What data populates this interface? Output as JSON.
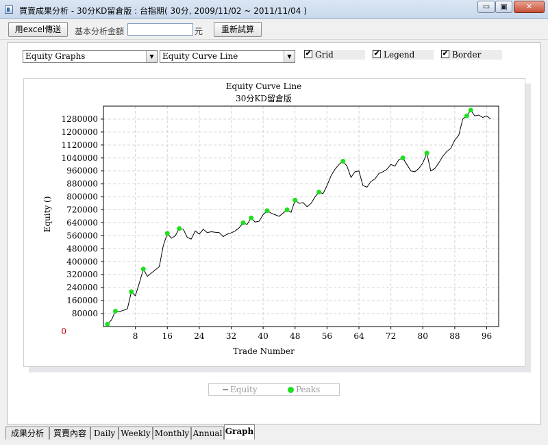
{
  "window": {
    "title": "買賣成果分析 - 30分KD留倉版 : 台指期( 30分, 2009/11/02 ~ 2011/11/04 )",
    "minimize_glyph": "▭",
    "maximize_glyph": "▣",
    "close_glyph": "✕"
  },
  "toolbar": {
    "export_label": "用excel傳送",
    "amount_label": "基本分析金額",
    "amount_value": "",
    "unit_label": "元",
    "recalc_label": "重新試算"
  },
  "controls": {
    "graph_type": "Equity Graphs",
    "graph_style": "Equity Curve Line",
    "dropdown_arrow": "▼",
    "check_mark": "✔",
    "grid": {
      "label": "Grid",
      "checked": true
    },
    "legend": {
      "label": "Legend",
      "checked": true
    },
    "border": {
      "label": "Border",
      "checked": true
    }
  },
  "chart_data": {
    "type": "line",
    "title": "Equity Curve Line",
    "subtitle": "30分KD留倉版",
    "xlabel": "Trade Number",
    "ylabel": "Equity ()",
    "xlim": [
      0,
      99
    ],
    "ylim": [
      0,
      1360000
    ],
    "x_ticks": [
      "8",
      "16",
      "24",
      "32",
      "40",
      "48",
      "56",
      "64",
      "72",
      "80",
      "88",
      "96"
    ],
    "y_ticks": [
      "80000",
      "160000",
      "240000",
      "320000",
      "400000",
      "480000",
      "560000",
      "640000",
      "720000",
      "800000",
      "880000",
      "960000",
      "1040000",
      "1120000",
      "1200000",
      "1280000"
    ],
    "zero_label": "0",
    "grid": true,
    "legend_position": "bottom",
    "series": [
      {
        "name": "Equity",
        "color": "#000000",
        "points": [
          [
            1,
            15000
          ],
          [
            2,
            40000
          ],
          [
            3,
            95000
          ],
          [
            4,
            92000
          ],
          [
            5,
            100000
          ],
          [
            6,
            110000
          ],
          [
            7,
            215000
          ],
          [
            8,
            190000
          ],
          [
            9,
            270000
          ],
          [
            10,
            355000
          ],
          [
            11,
            310000
          ],
          [
            12,
            330000
          ],
          [
            13,
            350000
          ],
          [
            14,
            370000
          ],
          [
            15,
            500000
          ],
          [
            16,
            575000
          ],
          [
            17,
            545000
          ],
          [
            18,
            560000
          ],
          [
            19,
            605000
          ],
          [
            20,
            600000
          ],
          [
            21,
            550000
          ],
          [
            22,
            540000
          ],
          [
            23,
            590000
          ],
          [
            24,
            570000
          ],
          [
            25,
            600000
          ],
          [
            26,
            580000
          ],
          [
            27,
            585000
          ],
          [
            28,
            582000
          ],
          [
            29,
            580000
          ],
          [
            30,
            555000
          ],
          [
            31,
            570000
          ],
          [
            32,
            578000
          ],
          [
            33,
            590000
          ],
          [
            34,
            610000
          ],
          [
            35,
            640000
          ],
          [
            36,
            630000
          ],
          [
            37,
            670000
          ],
          [
            38,
            645000
          ],
          [
            39,
            650000
          ],
          [
            40,
            690000
          ],
          [
            41,
            715000
          ],
          [
            42,
            700000
          ],
          [
            43,
            690000
          ],
          [
            44,
            680000
          ],
          [
            45,
            700000
          ],
          [
            46,
            720000
          ],
          [
            47,
            705000
          ],
          [
            48,
            780000
          ],
          [
            49,
            760000
          ],
          [
            50,
            765000
          ],
          [
            51,
            740000
          ],
          [
            52,
            760000
          ],
          [
            53,
            800000
          ],
          [
            54,
            830000
          ],
          [
            55,
            820000
          ],
          [
            56,
            870000
          ],
          [
            57,
            930000
          ],
          [
            58,
            970000
          ],
          [
            59,
            1000000
          ],
          [
            60,
            1020000
          ],
          [
            61,
            990000
          ],
          [
            62,
            920000
          ],
          [
            63,
            955000
          ],
          [
            64,
            960000
          ],
          [
            65,
            870000
          ],
          [
            66,
            860000
          ],
          [
            67,
            895000
          ],
          [
            68,
            910000
          ],
          [
            69,
            945000
          ],
          [
            70,
            955000
          ],
          [
            71,
            970000
          ],
          [
            72,
            1000000
          ],
          [
            73,
            990000
          ],
          [
            74,
            1030000
          ],
          [
            75,
            1040000
          ],
          [
            76,
            1000000
          ],
          [
            77,
            960000
          ],
          [
            78,
            955000
          ],
          [
            79,
            975000
          ],
          [
            80,
            1010000
          ],
          [
            81,
            1070000
          ],
          [
            82,
            960000
          ],
          [
            83,
            975000
          ],
          [
            84,
            1010000
          ],
          [
            85,
            1050000
          ],
          [
            86,
            1080000
          ],
          [
            87,
            1100000
          ],
          [
            88,
            1150000
          ],
          [
            89,
            1180000
          ],
          [
            90,
            1280000
          ],
          [
            91,
            1300000
          ],
          [
            92,
            1335000
          ],
          [
            93,
            1300000
          ],
          [
            94,
            1305000
          ],
          [
            95,
            1290000
          ],
          [
            96,
            1300000
          ],
          [
            97,
            1280000
          ]
        ]
      },
      {
        "name": "Peaks",
        "color": "#1ee01e",
        "points": [
          [
            1,
            15000
          ],
          [
            3,
            95000
          ],
          [
            7,
            215000
          ],
          [
            10,
            355000
          ],
          [
            16,
            575000
          ],
          [
            19,
            605000
          ],
          [
            35,
            640000
          ],
          [
            37,
            670000
          ],
          [
            41,
            715000
          ],
          [
            46,
            720000
          ],
          [
            48,
            780000
          ],
          [
            54,
            830000
          ],
          [
            60,
            1020000
          ],
          [
            75,
            1040000
          ],
          [
            81,
            1070000
          ],
          [
            91,
            1300000
          ],
          [
            92,
            1335000
          ]
        ]
      }
    ]
  },
  "tabs": [
    "成果分析",
    "買賣內容",
    "Daily",
    "Weekly",
    "Monthly",
    "Annual",
    "Graph"
  ],
  "active_tab": "Graph"
}
